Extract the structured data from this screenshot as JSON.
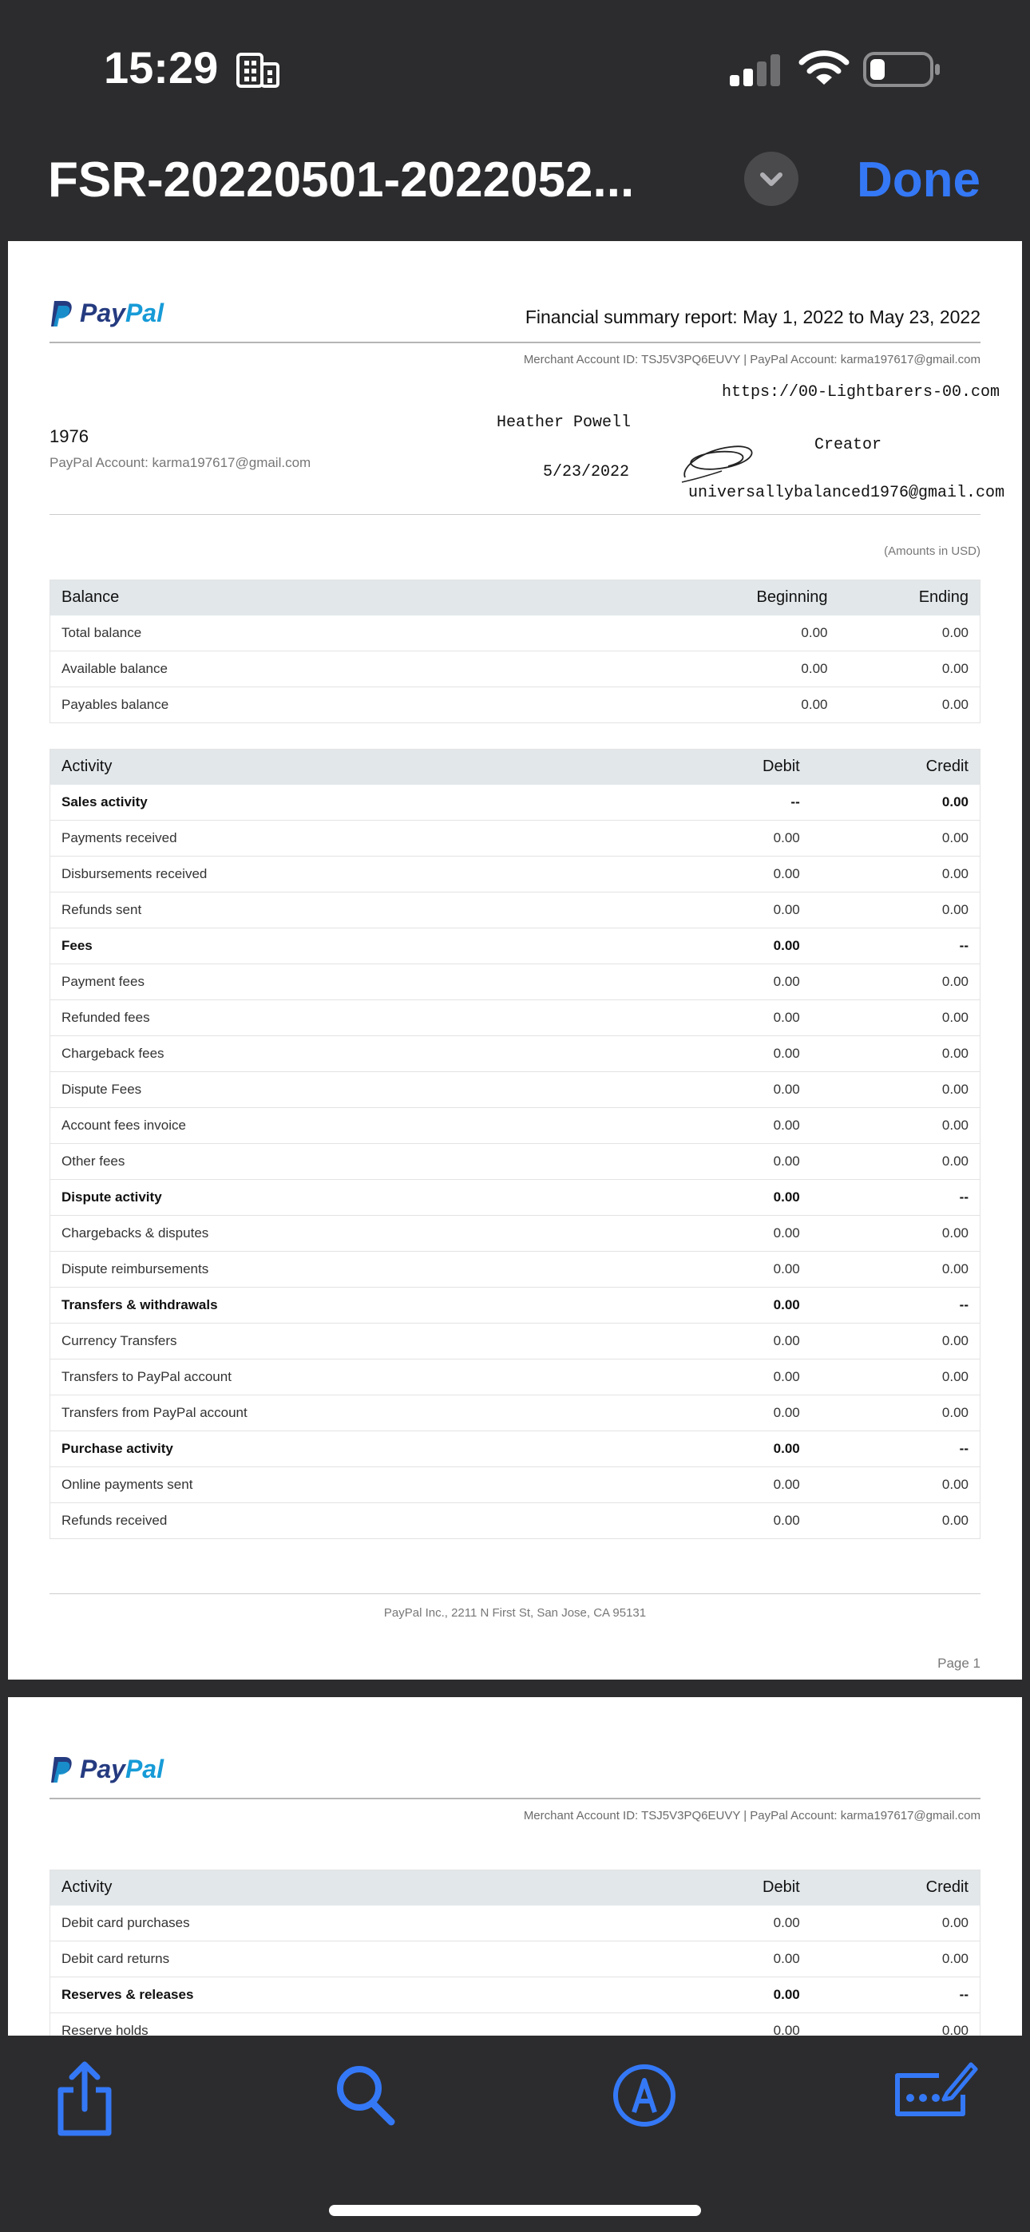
{
  "status_bar": {
    "time": "15:29"
  },
  "nav": {
    "title": "FSR-20220501-2022052...",
    "done_label": "Done"
  },
  "brand": {
    "pay": "Pay",
    "pal": "Pal"
  },
  "page1": {
    "report_title": "Financial summary report: May 1, 2022 to May 23, 2022",
    "merchant_line": "Merchant Account ID: TSJ5V3PQ6EUVY  |  PayPal Account: karma197617@gmail.com",
    "account_number": "1976",
    "account_email": "PayPal Account: karma197617@gmail.com",
    "annotations": {
      "url": "https://00-Lightbarers-00.com",
      "name": "Heather Powell",
      "role": "Creator",
      "date": "5/23/2022",
      "email": "universallybalanced1976@gmail.com"
    },
    "amounts_note": "(Amounts in USD)",
    "balance_table": {
      "headers": [
        "Balance",
        "Beginning",
        "Ending"
      ],
      "rows": [
        [
          "Total balance",
          "0.00",
          "0.00"
        ],
        [
          "Available balance",
          "0.00",
          "0.00"
        ],
        [
          "Payables balance",
          "0.00",
          "0.00"
        ]
      ]
    },
    "activity_table": {
      "headers": [
        "Activity",
        "Debit",
        "Credit"
      ],
      "rows": [
        [
          "Sales activity",
          "--",
          "0.00"
        ],
        [
          "Payments received",
          "0.00",
          "0.00"
        ],
        [
          "Disbursements received",
          "0.00",
          "0.00"
        ],
        [
          "Refunds sent",
          "0.00",
          "0.00"
        ],
        [
          "Fees",
          "0.00",
          "--"
        ],
        [
          "Payment fees",
          "0.00",
          "0.00"
        ],
        [
          "Refunded fees",
          "0.00",
          "0.00"
        ],
        [
          "Chargeback fees",
          "0.00",
          "0.00"
        ],
        [
          "Dispute Fees",
          "0.00",
          "0.00"
        ],
        [
          "Account fees invoice",
          "0.00",
          "0.00"
        ],
        [
          "Other fees",
          "0.00",
          "0.00"
        ],
        [
          "Dispute activity",
          "0.00",
          "--"
        ],
        [
          "Chargebacks & disputes",
          "0.00",
          "0.00"
        ],
        [
          "Dispute reimbursements",
          "0.00",
          "0.00"
        ],
        [
          "Transfers & withdrawals",
          "0.00",
          "--"
        ],
        [
          "Currency Transfers",
          "0.00",
          "0.00"
        ],
        [
          "Transfers to PayPal account",
          "0.00",
          "0.00"
        ],
        [
          "Transfers from PayPal account",
          "0.00",
          "0.00"
        ],
        [
          "Purchase activity",
          "0.00",
          "--"
        ],
        [
          "Online payments sent",
          "0.00",
          "0.00"
        ],
        [
          "Refunds received",
          "0.00",
          "0.00"
        ]
      ],
      "bold_rows": [
        0,
        4,
        11,
        14,
        18
      ]
    },
    "footer_address": "PayPal Inc., 2211 N First St, San Jose, CA 95131",
    "page_label": "Page  1"
  },
  "page2": {
    "merchant_line": "Merchant Account ID: TSJ5V3PQ6EUVY  |  PayPal Account: karma197617@gmail.com",
    "activity_table": {
      "headers": [
        "Activity",
        "Debit",
        "Credit"
      ],
      "rows": [
        [
          "Debit card purchases",
          "0.00",
          "0.00"
        ],
        [
          "Debit card returns",
          "0.00",
          "0.00"
        ],
        [
          "Reserves & releases",
          "0.00",
          "--"
        ],
        [
          "Reserve holds",
          "0.00",
          "0.00"
        ]
      ],
      "bold_rows": [
        2
      ]
    }
  },
  "toolbar": {
    "icons": [
      "share-icon",
      "search-icon",
      "markup-icon",
      "form-fill-icon"
    ]
  },
  "colors": {
    "accent": "#3478f6",
    "background": "#2c2c2e",
    "table_header": "#e2e7ea"
  }
}
